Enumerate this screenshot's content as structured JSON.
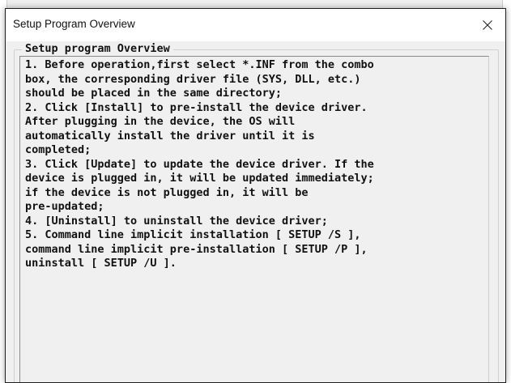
{
  "window": {
    "title": "Setup Program Overview",
    "close_glyph": "✕"
  },
  "group": {
    "label": "Setup program Overview"
  },
  "overview_text": {
    "lines": [
      "1. Before operation,first select *.INF from the combo",
      "box, the corresponding driver file (SYS, DLL, etc.)",
      "should be placed in the same directory;",
      "2. Click [Install] to pre-install the device driver.",
      "After plugging in the device, the OS will",
      "automatically install the driver until it is",
      "completed;",
      "3. Click [Update] to update the device driver. If the",
      "device is plugged in, it will be updated immediately;",
      "if the device is not plugged in, it will be",
      "pre-updated;",
      "4. [Uninstall] to uninstall the device driver;",
      "5. Command line implicit installation [ SETUP /S ],",
      "command line implicit pre-installation [ SETUP /P ],",
      "uninstall [ SETUP /U ]."
    ]
  },
  "colors": {
    "titlebar": "#ffffff",
    "window_bg": "#f0f0f0",
    "text": "#111111",
    "border": "#1f1f1f"
  },
  "icons": {
    "close": "close-icon"
  }
}
